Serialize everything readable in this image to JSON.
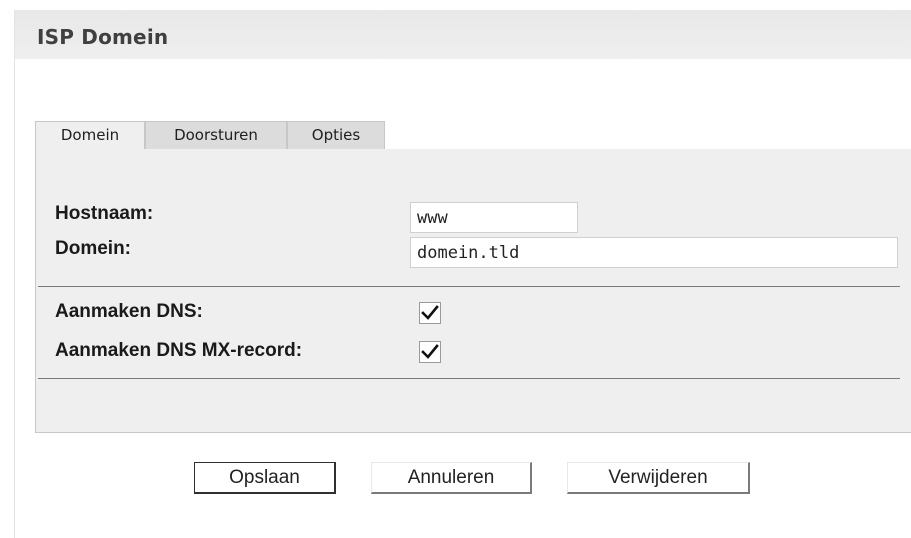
{
  "window": {
    "title": "ISP Domein"
  },
  "tabs": [
    {
      "label": "Domein",
      "active": true
    },
    {
      "label": "Doorsturen",
      "active": false
    },
    {
      "label": "Opties",
      "active": false
    }
  ],
  "form": {
    "hostnaam_label": "Hostnaam:",
    "hostnaam_value": "www",
    "domein_label": "Domein:",
    "domein_value": "domein.tld",
    "dns_label": "Aanmaken DNS:",
    "dns_checked": true,
    "mx_label": "Aanmaken DNS MX-record:",
    "mx_checked": true
  },
  "buttons": {
    "save": "Opslaan",
    "cancel": "Annuleren",
    "delete": "Verwijderen"
  },
  "icons": {
    "checkbox_check": "checkmark-icon"
  }
}
